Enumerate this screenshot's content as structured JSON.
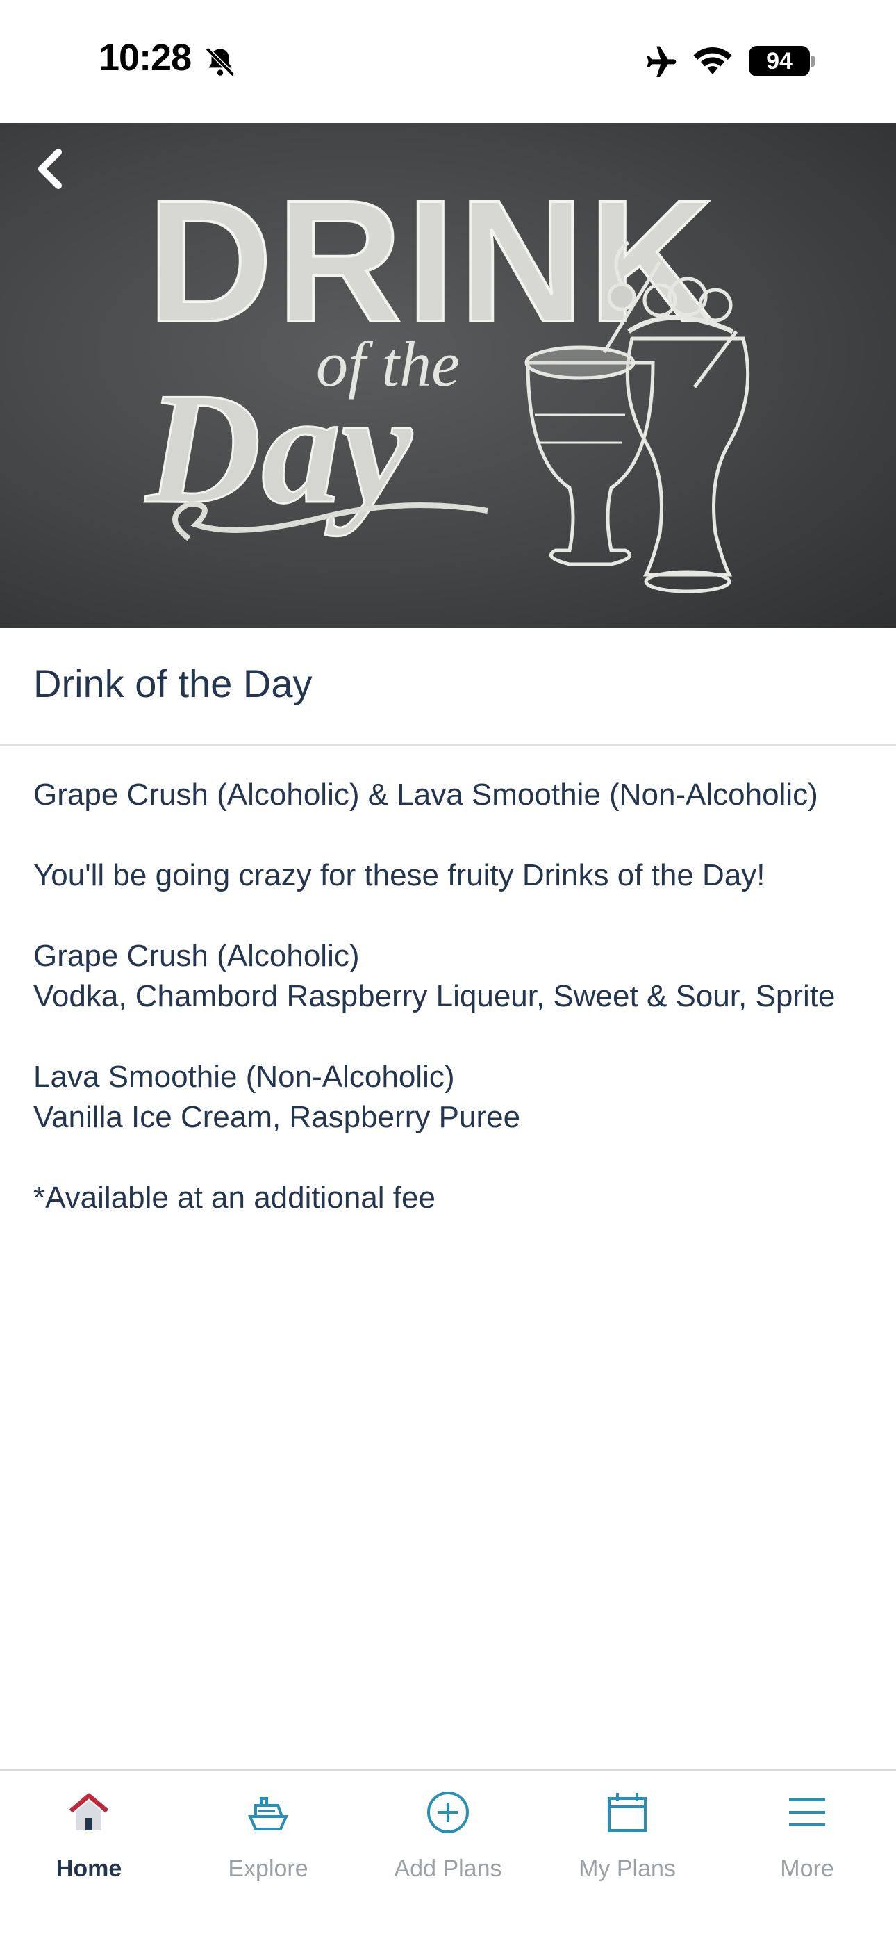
{
  "status_bar": {
    "time": "10:28",
    "battery_level": "94",
    "icons": [
      "bell-slash-icon",
      "airplane-icon",
      "wifi-icon",
      "battery-icon"
    ]
  },
  "hero": {
    "image_description_icon": "drink-of-the-day-chalkboard-image",
    "lettering": "DRINK of the Day"
  },
  "page": {
    "title": "Drink of the Day",
    "paragraphs": [
      [
        "Grape Crush (Alcoholic) & Lava Smoothie (Non-Alcoholic)"
      ],
      [
        "You'll be going crazy for these fruity Drinks of the Day!"
      ],
      [
        "Grape Crush (Alcoholic)",
        "Vodka, Chambord Raspberry Liqueur, Sweet & Sour, Sprite"
      ],
      [
        "Lava Smoothie (Non-Alcoholic)",
        "Vanilla Ice Cream, Raspberry Puree"
      ],
      [
        "*Available at an additional fee"
      ]
    ]
  },
  "tab_bar": {
    "tabs": [
      {
        "label": "Home",
        "icon": "home-icon",
        "active": true
      },
      {
        "label": "Explore",
        "icon": "ship-icon",
        "active": false
      },
      {
        "label": "Add Plans",
        "icon": "plus-circle-icon",
        "active": false
      },
      {
        "label": "My Plans",
        "icon": "calendar-icon",
        "active": false
      },
      {
        "label": "More",
        "icon": "menu-icon",
        "active": false
      }
    ]
  },
  "colors": {
    "text": "#24354f",
    "tab_inactive": "#9aa0a6",
    "tab_icon": "#2a8fb5",
    "home_roof": "#c0283a",
    "chalkboard": "#444647"
  }
}
